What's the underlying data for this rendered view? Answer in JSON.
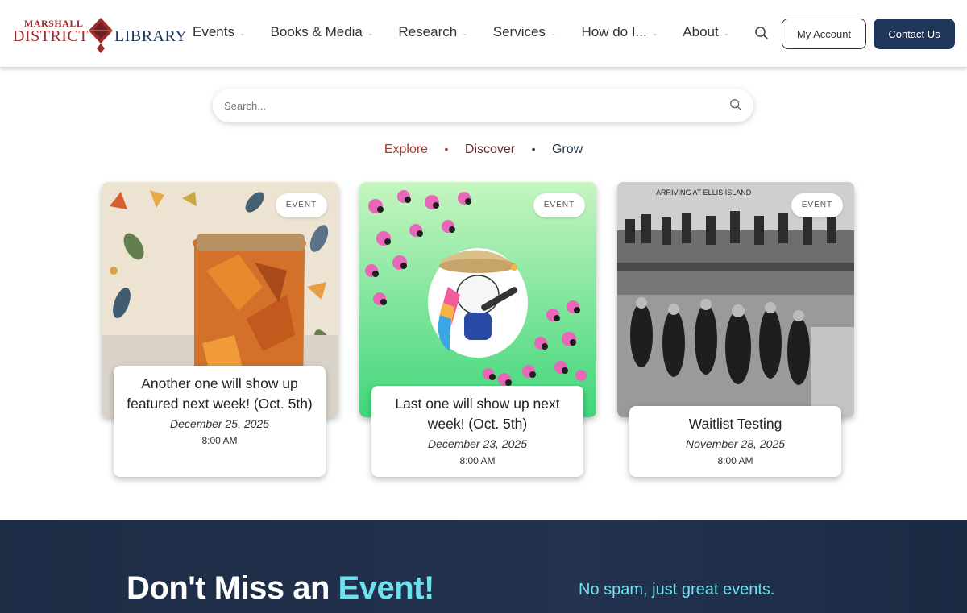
{
  "header": {
    "logo": {
      "small": "MARSHALL",
      "left": "DISTRICT",
      "right": "LIBRARY"
    },
    "nav": [
      {
        "label": "Events"
      },
      {
        "label": "Books & Media"
      },
      {
        "label": "Research"
      },
      {
        "label": "Services"
      },
      {
        "label": "How do I..."
      },
      {
        "label": "About"
      }
    ],
    "account_label": "My Account",
    "contact_label": "Contact Us"
  },
  "search": {
    "placeholder": "Search..."
  },
  "tagline": {
    "words": [
      "Explore",
      "Discover",
      "Grow"
    ],
    "separator": "•"
  },
  "events": [
    {
      "badge": "EVENT",
      "title": "Another one will show up featured next week! (Oct. 5th)",
      "date": "December 25, 2025",
      "time": "8:00 AM"
    },
    {
      "badge": "EVENT",
      "title": "Last one will show up next week! (Oct. 5th)",
      "date": "December 23, 2025",
      "time": "8:00 AM"
    },
    {
      "badge": "EVENT",
      "title": "Waitlist Testing",
      "date": "November 28, 2025",
      "time": "8:00 AM"
    }
  ],
  "photo_caption": "ARRIVING AT ELLIS ISLAND",
  "newsletter": {
    "title_prefix": "Don't Miss an ",
    "title_accent": "Event!",
    "subtitle": "No spam, just great events."
  },
  "colors": {
    "brand_red": "#9e2a2b",
    "brand_navy": "#1f3559",
    "accent_cyan": "#6fe0ee"
  }
}
